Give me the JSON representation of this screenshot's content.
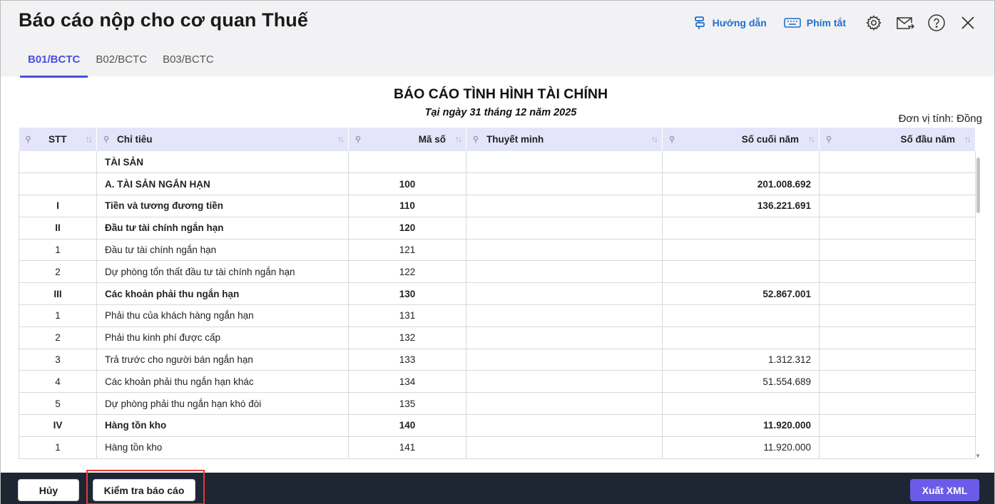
{
  "window": {
    "title": "Báo cáo nộp cho cơ quan Thuế"
  },
  "toolbar": {
    "guide_label": "Hướng dẫn",
    "shortcut_label": "Phím tắt"
  },
  "tabs": [
    {
      "label": "B01/BCTC",
      "active": true
    },
    {
      "label": "B02/BCTC",
      "active": false
    },
    {
      "label": "B03/BCTC",
      "active": false
    }
  ],
  "report": {
    "title": "BÁO CÁO TÌNH HÌNH TÀI CHÍNH",
    "subtitle": "Tại ngày 31 tháng 12 năm 2025",
    "unit": "Đơn vị tính: Đồng"
  },
  "table": {
    "columns": [
      "STT",
      "Chỉ tiêu",
      "Mã số",
      "Thuyết minh",
      "Số cuối năm",
      "Số đầu năm"
    ],
    "rows": [
      {
        "stt": "",
        "name": "TÀI SẢN",
        "code": "",
        "note": "",
        "end": "",
        "start": "",
        "bold": true
      },
      {
        "stt": "",
        "name": "A. TÀI SẢN NGẮN HẠN",
        "code": "100",
        "note": "",
        "end": "201.008.692",
        "start": "",
        "bold": true
      },
      {
        "stt": "I",
        "name": "Tiền và tương đương tiền",
        "code": "110",
        "note": "",
        "end": "136.221.691",
        "start": "",
        "bold": true
      },
      {
        "stt": "II",
        "name": "Đầu tư tài chính ngắn hạn",
        "code": "120",
        "note": "",
        "end": "",
        "start": "",
        "bold": true
      },
      {
        "stt": "1",
        "name": "Đầu tư tài chính ngắn hạn",
        "code": "121",
        "note": "",
        "end": "",
        "start": "",
        "bold": false
      },
      {
        "stt": "2",
        "name": "Dự phòng tổn thất đầu tư tài chính ngắn hạn",
        "code": "122",
        "note": "",
        "end": "",
        "start": "",
        "bold": false
      },
      {
        "stt": "III",
        "name": "Các khoản phải thu ngắn hạn",
        "code": "130",
        "note": "",
        "end": "52.867.001",
        "start": "",
        "bold": true
      },
      {
        "stt": "1",
        "name": "Phải thu của khách hàng ngắn hạn",
        "code": "131",
        "note": "",
        "end": "",
        "start": "",
        "bold": false
      },
      {
        "stt": "2",
        "name": "Phải thu kinh phí được cấp",
        "code": "132",
        "note": "",
        "end": "",
        "start": "",
        "bold": false
      },
      {
        "stt": "3",
        "name": "Trả trước cho người bán ngắn hạn",
        "code": "133",
        "note": "",
        "end": "1.312.312",
        "start": "",
        "bold": false
      },
      {
        "stt": "4",
        "name": "Các khoản phải thu ngắn hạn khác",
        "code": "134",
        "note": "",
        "end": "51.554.689",
        "start": "",
        "bold": false
      },
      {
        "stt": "5",
        "name": "Dự phòng phải thu ngắn hạn khó đòi",
        "code": "135",
        "note": "",
        "end": "",
        "start": "",
        "bold": false
      },
      {
        "stt": "IV",
        "name": "Hàng tồn kho",
        "code": "140",
        "note": "",
        "end": "11.920.000",
        "start": "",
        "bold": true
      },
      {
        "stt": "1",
        "name": "Hàng tồn kho",
        "code": "141",
        "note": "",
        "end": "11.920.000",
        "start": "",
        "bold": false
      },
      {
        "stt": "",
        "name": "",
        "code": "",
        "note": "",
        "end": "",
        "start": "",
        "bold": false
      }
    ]
  },
  "footer": {
    "cancel_label": "Hủy",
    "check_label": "Kiểm tra báo cáo",
    "export_label": "Xuất XML"
  },
  "colors": {
    "accent": "#4a4ee2",
    "link": "#1f6fd1",
    "footer_bg": "#1e2533",
    "export_bg": "#6a5be8",
    "header_row": "#e4e5fa",
    "highlight": "#e53935"
  },
  "icons": [
    "guide-icon",
    "keyboard-icon",
    "gear-icon",
    "mail-forward-icon",
    "help-icon",
    "close-icon",
    "pin-icon",
    "sort-icon"
  ]
}
